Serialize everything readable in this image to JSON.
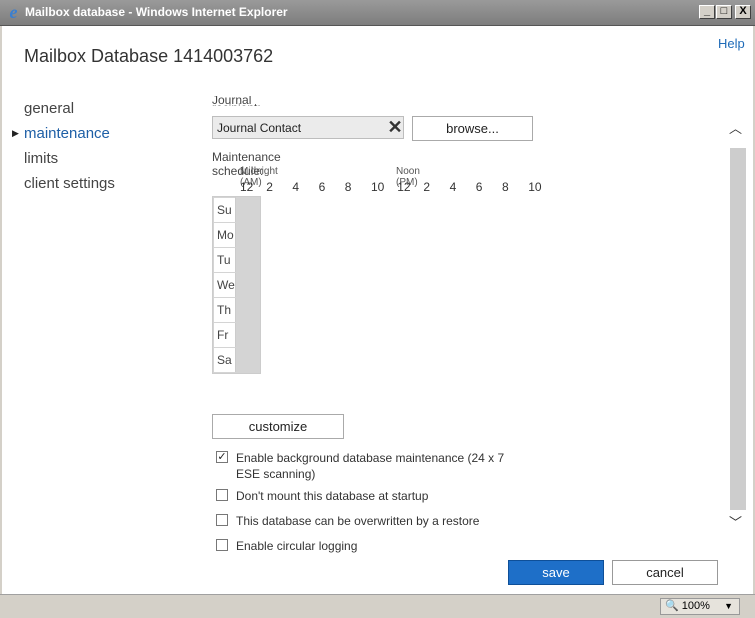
{
  "window": {
    "title": "Mailbox database - Windows Internet Explorer",
    "min": "_",
    "max": "□",
    "close": "X"
  },
  "help": "Help",
  "page_title": "Mailbox Database 1414003762",
  "nav": [
    {
      "label": "general",
      "active": false
    },
    {
      "label": "maintenance",
      "active": true
    },
    {
      "label": "limits",
      "active": false
    },
    {
      "label": "client settings",
      "active": false
    }
  ],
  "journal": {
    "label": "Journal recipient:",
    "value": "Journal Contact",
    "clear": "✕",
    "browse": "browse..."
  },
  "schedule": {
    "label": "Maintenance schedule:",
    "am_label": "Midnight (AM)",
    "pm_label": "Noon (PM)",
    "hours": [
      "12",
      "2",
      "4",
      "6",
      "8",
      "10",
      "12",
      "2",
      "4",
      "6",
      "8",
      "10"
    ],
    "days": [
      "Su",
      "Mo",
      "Tu",
      "We",
      "Th",
      "Fr",
      "Sa"
    ],
    "selected_slots": [
      1,
      2,
      3,
      4
    ]
  },
  "customize": "customize",
  "checkboxes": [
    {
      "line1": "Enable background database maintenance (24 x 7",
      "line2": "ESE scanning)",
      "checked": true
    },
    {
      "line1": "Don't mount this database at startup",
      "checked": false
    },
    {
      "line1": "This database can be overwritten by a restore",
      "checked": false
    },
    {
      "line1": "Enable circular logging",
      "checked": false
    }
  ],
  "buttons": {
    "save": "save",
    "cancel": "cancel"
  },
  "status": {
    "zoom": "100%"
  },
  "icons": {
    "scroll_up": "chevron-up-icon",
    "scroll_down": "chevron-down-icon",
    "zoom": "magnifier-icon"
  }
}
